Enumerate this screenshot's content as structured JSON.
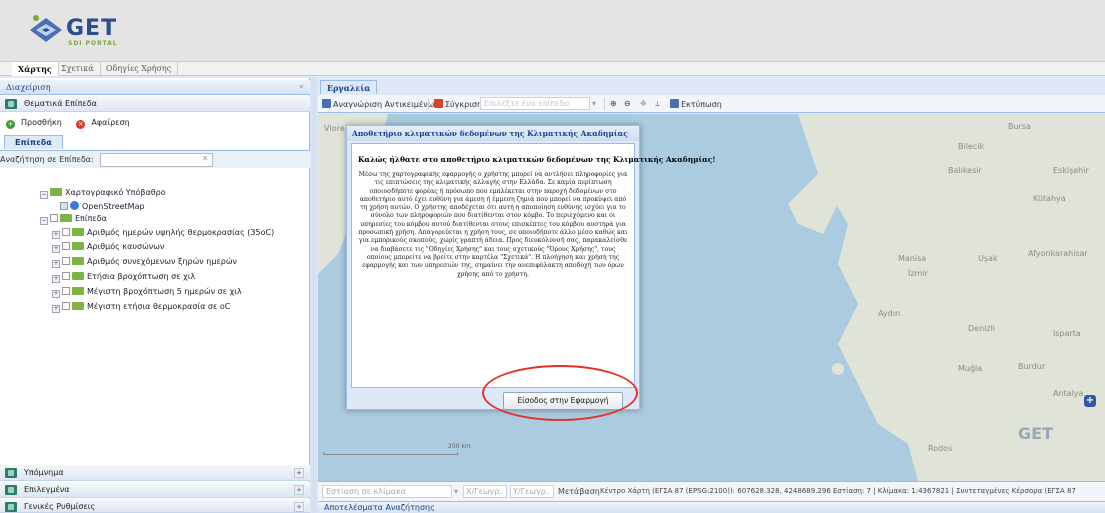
{
  "header": {
    "logo_text": "GET",
    "logo_sub": "SDI PORTAL"
  },
  "top_tabs": [
    "Χάρτης",
    "Σχετικά",
    "Οδηγίες Χρήσης"
  ],
  "left": {
    "panel_title": "Διαχείριση",
    "collapse_glyph": "«",
    "thematic_layers": "Θεματικά Επίπεδα",
    "add_label": "Προσθήκη",
    "remove_label": "Αφαίρεση",
    "layers_tab": "Επίπεδα",
    "search_label": "Αναζήτηση σε Επίπεδα:",
    "search_value": "",
    "tree": {
      "base_folder": "Χαρτογραφικό Υπόβαθρο",
      "osm": "OpenStreetMap",
      "layers_folder": "Επίπεδα",
      "layers": [
        "Αριθμός ημερών υψηλής θερμοκρασίας (35oC)",
        "Αριθμός καυσώνων",
        "Αριθμός συνεχόμενων ξηρών ημερών",
        "Ετήσια βροχόπτωση σε χιλ",
        "Μέγιστη βροχόπτωση 5 ημερών σε χιλ",
        "Μέγιστη ετήσια θερμοκρασία σε oC"
      ]
    },
    "legend": "Υπόμνημα",
    "selected": "Επιλεγμένα",
    "general_settings": "Γενικές Ρυθμίσεις"
  },
  "right": {
    "tools_tab": "Εργαλεία",
    "toolbar": {
      "identify": "Αναγνώριση Αντικειμένων",
      "compare": "Σύγκριση",
      "select_layer_placeholder": "Επιλέξτε ένα επίπεδο",
      "print": "Εκτύπωση"
    },
    "footer": {
      "zoom_placeholder": "Εστίαση σε κλίμακα",
      "x_placeholder": "X/Γεωγρ.",
      "y_placeholder": "Y/Γεωγρ.",
      "go": "Μετάβαση",
      "status": "Κέντρο Χάρτη (ΕΓΣΑ 87 (EPSG:2100)): 607628.328, 4248689.296 Εστίαση: 7 | Κλίμακα: 1:4367821 | Συντεταγμένες Κέρσορα (ΕΓΣΑ 87"
    },
    "results": "Αποτελέσματα Αναζήτησης",
    "scale_label": "200 km",
    "map_labels": [
      "Vlore",
      "Bursa",
      "Bilecik",
      "Balıkesir",
      "Eskişehir",
      "Kütahya",
      "Manisa",
      "İzmir",
      "Uşak",
      "Afyonkarahisar",
      "Aydın",
      "Denizli",
      "Isparta",
      "Muğla",
      "Burdur",
      "Antalya",
      "Rodos"
    ],
    "map_watermark": "GET"
  },
  "modal": {
    "title": "Αποθετήριο κλιματικών δεδομένων της Κλιματικής Ακαδημίας",
    "heading": "Καλώς ήλθατε στο αποθετήριο κλιματικών δεδομένων της Κλιματικής Ακαδημίας!",
    "body": "Μέσω της χαρτογραφικής εφαρμογής ο χρήστης μπορεί να αντλήσει πληροφορίες για τις επιπτώσεις της κλιματικής αλλαγής στην Ελλάδα. Σε καμία περίπτωση οποιοσδήποτε φορέας ή πρόσωπο που εμπλέκεται στην παροχή δεδομένων στο αποθετήριο αυτό έχει ευθύνη για άμεση ή έμμεση ζημιά που μπορεί να προκύψει από τη χρήση αυτών. Ο χρήστης αποδέχεται ότι αυτή η αποποίηση ευθύνης ισχύει για το σύνολο των πληροφοριών που διατίθενται στον κόμβο. Το περιεχόμενο και οι υπηρεσίες του κόμβου αυτού διατίθενται στους επισκέπτες του κόμβου αυστηρά για προσωπική χρήση. Απαγορεύεται η χρήση τους, σε οποιοδήποτε άλλο μέσο καθώς και για εμπορικούς σκοπούς, χωρίς γραπτή άδεια. Προς διευκόλυνσή σας, παρακαλείσθε να διαβάσετε τις \"Οδηγίες Χρήσης\" και τους σχετικούς \"Όρους Χρήσης\", τους οποίους μπορείτε να βρείτε στην καρτέλα \"Σχετικά\". Η πλοήγηση και χρήση της εφαρμογής και των υπηρεσιών της, σημαίνει την ανεπιφύλακτη αποδοχή των όρων χρήσης από το χρήστη.",
    "button": "Είσοδος στην Εφαρμογή"
  },
  "colors": {
    "accent": "#15428b",
    "annotation": "#e4322a"
  }
}
